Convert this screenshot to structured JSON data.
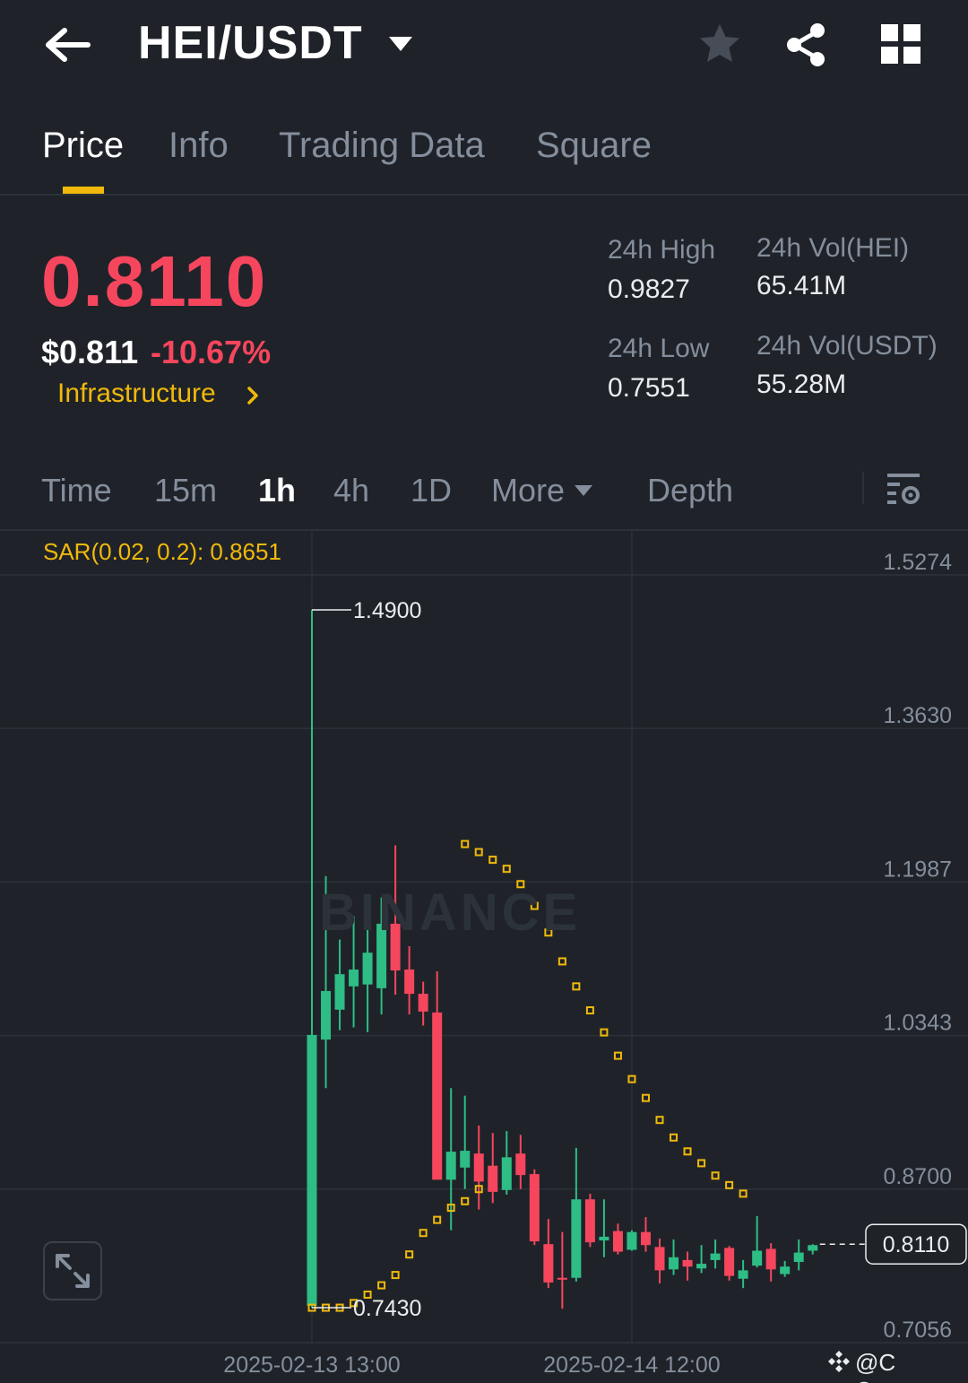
{
  "header": {
    "pair": "HEI/USDT",
    "icons": [
      "back-arrow-icon",
      "caret-down-icon",
      "star-icon",
      "share-icon",
      "grid-icon"
    ]
  },
  "tabs": [
    {
      "label": "Price",
      "active": true
    },
    {
      "label": "Info",
      "active": false
    },
    {
      "label": "Trading Data",
      "active": false
    },
    {
      "label": "Square",
      "active": false
    }
  ],
  "ticker": {
    "last_price": "0.8110",
    "usd_price": "$0.811",
    "change_pct": "-10.67%",
    "sector": "Infrastructure",
    "high_label": "24h High",
    "high_value": "0.9827",
    "low_label": "24h Low",
    "low_value": "0.7551",
    "vol_base_label": "24h Vol(HEI)",
    "vol_base_value": "65.41M",
    "vol_quote_label": "24h Vol(USDT)",
    "vol_quote_value": "55.28M"
  },
  "intervals": {
    "items": [
      "Time",
      "15m",
      "1h",
      "4h",
      "1D"
    ],
    "active": "1h",
    "more_label": "More",
    "depth_label": "Depth"
  },
  "colors": {
    "background": "#1f2329",
    "up": "#2ebd85",
    "down": "#f6465d",
    "accent": "#f0b90b",
    "muted": "#848e9c"
  },
  "chart_data": {
    "type": "candlestick",
    "indicator_label": "SAR(0.02, 0.2): 0.8651",
    "y_ticks": [
      "1.5274",
      "1.3630",
      "1.1987",
      "1.0343",
      "0.8700",
      "0.7056"
    ],
    "ylim": [
      0.7056,
      1.5274
    ],
    "x_ticks": [
      {
        "label": "2025-02-13 13:00",
        "index": 0
      },
      {
        "label": "2025-02-14 12:00",
        "index": 23
      }
    ],
    "max_label": "1.4900",
    "min_label": "0.7430",
    "last_price_label": "0.8110",
    "watermark": "BINANCE",
    "candles": [
      {
        "o": 0.745,
        "h": 1.49,
        "l": 0.743,
        "c": 1.035
      },
      {
        "o": 1.03,
        "h": 1.205,
        "l": 0.978,
        "c": 1.082
      },
      {
        "o": 1.062,
        "h": 1.137,
        "l": 1.04,
        "c": 1.1
      },
      {
        "o": 1.087,
        "h": 1.162,
        "l": 1.043,
        "c": 1.105
      },
      {
        "o": 1.089,
        "h": 1.156,
        "l": 1.038,
        "c": 1.123
      },
      {
        "o": 1.085,
        "h": 1.182,
        "l": 1.057,
        "c": 1.154
      },
      {
        "o": 1.154,
        "h": 1.238,
        "l": 1.078,
        "c": 1.104
      },
      {
        "o": 1.105,
        "h": 1.13,
        "l": 1.057,
        "c": 1.079
      },
      {
        "o": 1.079,
        "h": 1.092,
        "l": 1.045,
        "c": 1.06
      },
      {
        "o": 1.059,
        "h": 1.103,
        "l": 1.035,
        "c": 0.88
      },
      {
        "o": 0.88,
        "h": 0.978,
        "l": 0.826,
        "c": 0.91
      },
      {
        "o": 0.893,
        "h": 0.97,
        "l": 0.87,
        "c": 0.911
      },
      {
        "o": 0.908,
        "h": 0.938,
        "l": 0.848,
        "c": 0.878
      },
      {
        "o": 0.895,
        "h": 0.93,
        "l": 0.855,
        "c": 0.867
      },
      {
        "o": 0.869,
        "h": 0.932,
        "l": 0.864,
        "c": 0.904
      },
      {
        "o": 0.908,
        "h": 0.928,
        "l": 0.87,
        "c": 0.885
      },
      {
        "o": 0.886,
        "h": 0.891,
        "l": 0.81,
        "c": 0.814
      },
      {
        "o": 0.811,
        "h": 0.838,
        "l": 0.764,
        "c": 0.77
      },
      {
        "o": 0.775,
        "h": 0.824,
        "l": 0.742,
        "c": 0.773
      },
      {
        "o": 0.775,
        "h": 0.914,
        "l": 0.771,
        "c": 0.859
      },
      {
        "o": 0.859,
        "h": 0.865,
        "l": 0.808,
        "c": 0.813
      },
      {
        "o": 0.815,
        "h": 0.859,
        "l": 0.797,
        "c": 0.819
      },
      {
        "o": 0.825,
        "h": 0.833,
        "l": 0.8,
        "c": 0.803
      },
      {
        "o": 0.805,
        "h": 0.826,
        "l": 0.804,
        "c": 0.824
      },
      {
        "o": 0.824,
        "h": 0.84,
        "l": 0.803,
        "c": 0.81
      },
      {
        "o": 0.808,
        "h": 0.817,
        "l": 0.769,
        "c": 0.783
      },
      {
        "o": 0.784,
        "h": 0.816,
        "l": 0.778,
        "c": 0.797
      },
      {
        "o": 0.794,
        "h": 0.803,
        "l": 0.772,
        "c": 0.787
      },
      {
        "o": 0.785,
        "h": 0.81,
        "l": 0.78,
        "c": 0.79
      },
      {
        "o": 0.794,
        "h": 0.816,
        "l": 0.785,
        "c": 0.801
      },
      {
        "o": 0.807,
        "h": 0.809,
        "l": 0.772,
        "c": 0.777
      },
      {
        "o": 0.774,
        "h": 0.794,
        "l": 0.764,
        "c": 0.783
      },
      {
        "o": 0.788,
        "h": 0.841,
        "l": 0.786,
        "c": 0.804
      },
      {
        "o": 0.806,
        "h": 0.812,
        "l": 0.771,
        "c": 0.784
      },
      {
        "o": 0.779,
        "h": 0.793,
        "l": 0.776,
        "c": 0.787
      },
      {
        "o": 0.792,
        "h": 0.816,
        "l": 0.783,
        "c": 0.802
      },
      {
        "o": 0.804,
        "h": 0.811,
        "l": 0.8,
        "c": 0.81
      }
    ],
    "sar": [
      {
        "i": 0,
        "v": 0.743
      },
      {
        "i": 1,
        "v": 0.743
      },
      {
        "i": 2,
        "v": 0.743
      },
      {
        "i": 3,
        "v": 0.748
      },
      {
        "i": 4,
        "v": 0.757
      },
      {
        "i": 5,
        "v": 0.767
      },
      {
        "i": 6,
        "v": 0.778
      },
      {
        "i": 7,
        "v": 0.8
      },
      {
        "i": 8,
        "v": 0.823
      },
      {
        "i": 9,
        "v": 0.837
      },
      {
        "i": 10,
        "v": 0.85
      },
      {
        "i": 11,
        "v": 0.857
      },
      {
        "i": 12,
        "v": 0.87
      },
      {
        "i": 11,
        "v": 1.2393
      },
      {
        "i": 12,
        "v": 1.2307
      },
      {
        "i": 13,
        "v": 1.2225
      },
      {
        "i": 14,
        "v": 1.2128
      },
      {
        "i": 15,
        "v": 1.1964
      },
      {
        "i": 16,
        "v": 1.1731
      },
      {
        "i": 17,
        "v": 1.1446
      },
      {
        "i": 18,
        "v": 1.1137
      },
      {
        "i": 19,
        "v": 1.0869
      },
      {
        "i": 20,
        "v": 1.0613
      },
      {
        "i": 21,
        "v": 1.0377
      },
      {
        "i": 22,
        "v": 1.0127
      },
      {
        "i": 23,
        "v": 0.9877
      },
      {
        "i": 24,
        "v": 0.9675
      },
      {
        "i": 25,
        "v": 0.944
      },
      {
        "i": 26,
        "v": 0.9252
      },
      {
        "i": 27,
        "v": 0.9103
      },
      {
        "i": 28,
        "v": 0.8977
      },
      {
        "i": 29,
        "v": 0.8844
      },
      {
        "i": 30,
        "v": 0.8742
      },
      {
        "i": 31,
        "v": 0.8651
      }
    ]
  },
  "footer": {
    "credit": "@C Queen"
  }
}
